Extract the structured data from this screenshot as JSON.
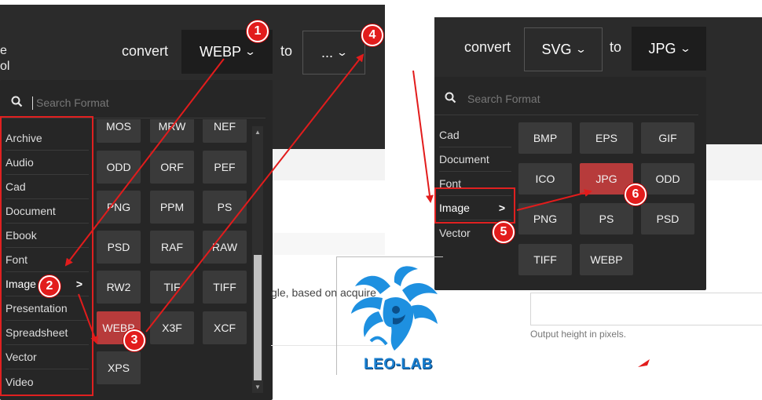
{
  "left": {
    "header_fragment_1": "e",
    "header_fragment_2": "ol",
    "convert_label": "convert",
    "from_format": "WEBP",
    "to_label": "to",
    "to_format": "...",
    "search_placeholder": "Search Format",
    "categories": [
      "Archive",
      "Audio",
      "Cad",
      "Document",
      "Ebook",
      "Font",
      "Image",
      "Presentation",
      "Spreadsheet",
      "Vector",
      "Video"
    ],
    "active_category": "Image",
    "active_chevron": ">",
    "formats_partial_top": [
      "MOS",
      "MRW",
      "NEF"
    ],
    "formats": [
      "ODD",
      "ORF",
      "PEF",
      "PNG",
      "PPM",
      "PS",
      "PSD",
      "RAF",
      "RAW",
      "RW2",
      "TIF",
      "TIFF",
      "WEBP",
      "X3F",
      "XCF",
      "XPS"
    ],
    "selected_format": "WEBP",
    "background_text": "gle, based on acquire"
  },
  "right": {
    "convert_label": "convert",
    "from_format": "SVG",
    "to_label": "to",
    "to_format": "JPG",
    "search_placeholder": "Search Format",
    "categories": [
      "Cad",
      "Document",
      "Font",
      "Image",
      "Vector"
    ],
    "active_category": "Image",
    "active_chevron": ">",
    "formats": [
      "BMP",
      "EPS",
      "GIF",
      "ICO",
      "JPG",
      "ODD",
      "PNG",
      "PS",
      "PSD",
      "TIFF",
      "WEBP"
    ],
    "selected_format": "JPG",
    "height_hint": "Output height in pixels."
  },
  "annotations": {
    "badges": [
      "1",
      "2",
      "3",
      "4",
      "5",
      "6"
    ],
    "color": "#e21c1c"
  },
  "logo": {
    "text": "LEO-LAB",
    "color": "#1a7fd0"
  },
  "icons": {
    "search": "search-icon",
    "chevron_down": "chevron-down-icon",
    "chevron_right": "chevron-right-icon"
  }
}
